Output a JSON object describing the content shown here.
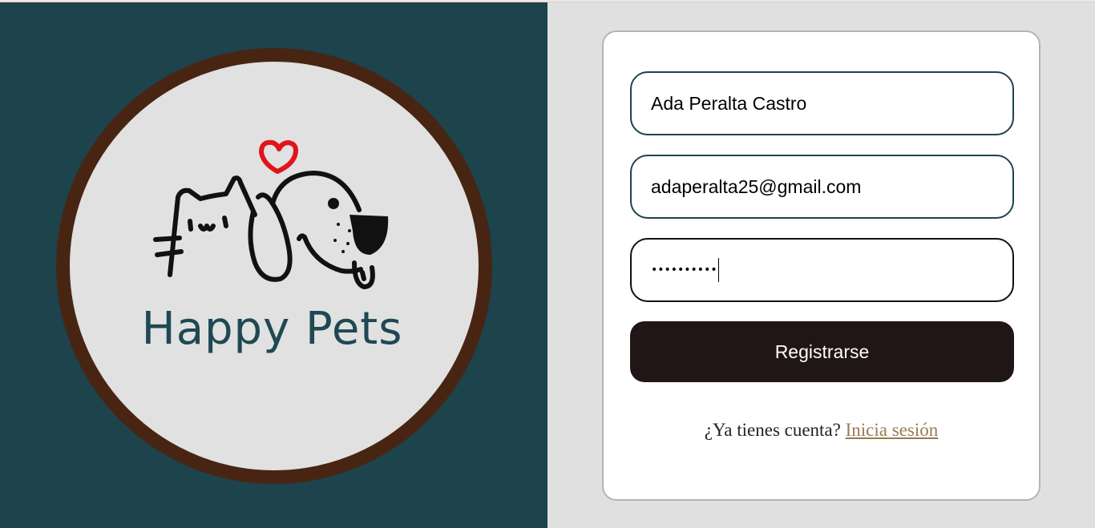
{
  "brand": {
    "name": "Happy Pets"
  },
  "form": {
    "name_value": "Ada Peralta Castro",
    "email_value": "adaperalta25@gmail.com",
    "password_mask": "••••••••••",
    "submit_label": "Registrarse",
    "login_prompt": "¿Ya tienes cuenta?",
    "login_link": "Inicia sesión"
  },
  "colors": {
    "left_panel": "#1d434c",
    "logo_ring": "#482513",
    "button": "#201615",
    "link": "#9a7a52",
    "heart": "#e0141b"
  },
  "icons": [
    "cat-icon",
    "dog-icon",
    "heart-icon"
  ]
}
